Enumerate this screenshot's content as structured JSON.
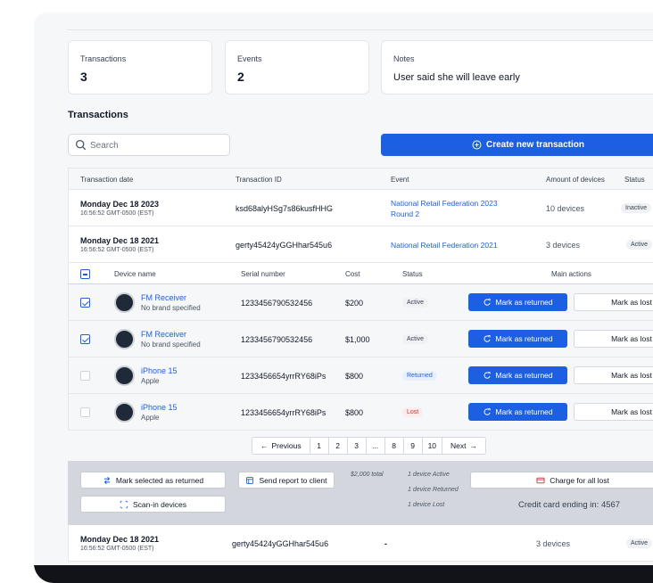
{
  "summary": {
    "transactions_label": "Transactions",
    "transactions_value": "3",
    "events_label": "Events",
    "events_value": "2",
    "notes_label": "Notes",
    "notes_value": "User said she will leave early"
  },
  "section_title": "Transactions",
  "search": {
    "placeholder": "Search"
  },
  "create_button": "Create new transaction",
  "table": {
    "headers": [
      "Transaction date",
      "Transaction ID",
      "Event",
      "Amount of devices",
      "Status"
    ],
    "rows": [
      {
        "date": "Monday Dec 18 2023",
        "time": "16:56:52 GMT-0500 (EST)",
        "id": "ksd68alyHSg7s86kusfHHG",
        "event_line1": "National Retail Federation 2023",
        "event_line2": "Round 2",
        "devices": "10 devices",
        "status": "Inactive"
      },
      {
        "date": "Monday Dec 18 2021",
        "time": "16:56:52 GMT-0500 (EST)",
        "id": "gerty45424yGGHhar545u6",
        "event_line1": "National Retail Federation 2021",
        "event_line2": "",
        "devices": "3 devices",
        "status": "Active"
      },
      {
        "date": "Monday Dec 18 2021",
        "time": "16:56:52 GMT-0500 (EST)",
        "id": "gerty45424yGGHhar545u6",
        "event_line1": "-",
        "event_line2": "",
        "devices": "3 devices",
        "status": "Active"
      }
    ]
  },
  "devices": {
    "headers": [
      "Device name",
      "Serial number",
      "Cost",
      "Status",
      "Main actions"
    ],
    "mark_returned_label": "Mark as returned",
    "mark_lost_label": "Mark as lost",
    "rows": [
      {
        "name": "FM Receiver",
        "brand": "No brand specified",
        "serial": "1233456790532456",
        "cost": "$200",
        "status": "Active",
        "checked": true
      },
      {
        "name": "FM Receiver",
        "brand": "No brand specified",
        "serial": "1233456790532456",
        "cost": "$1,000",
        "status": "Active",
        "checked": true
      },
      {
        "name": "iPhone 15",
        "brand": "Apple",
        "serial": "1233456654yrrRY68iPs",
        "cost": "$800",
        "status": "Returned",
        "checked": false
      },
      {
        "name": "iPhone 15",
        "brand": "Apple",
        "serial": "1233456654yrrRY68iPs",
        "cost": "$800",
        "status": "Lost",
        "checked": false
      }
    ]
  },
  "pagination": {
    "previous": "Previous",
    "next": "Next",
    "pages": [
      "1",
      "2",
      "3",
      "...",
      "8",
      "9",
      "10"
    ]
  },
  "bulk": {
    "mark_selected_returned": "Mark selected as returned",
    "scan_in": "Scan-in devices",
    "send_report": "Send report to client",
    "total": "$2,000 total",
    "active_count": "1 device Active",
    "returned_count": "1 device Returned",
    "lost_count": "1 device Lost",
    "charge_all_lost": "Charge for all lost",
    "credit_card": "Credit card ending in: 4567"
  },
  "colors": {
    "accent": "#1d5fe3",
    "bulk_bar": "#d3d7dd",
    "lost": "#c53030"
  }
}
